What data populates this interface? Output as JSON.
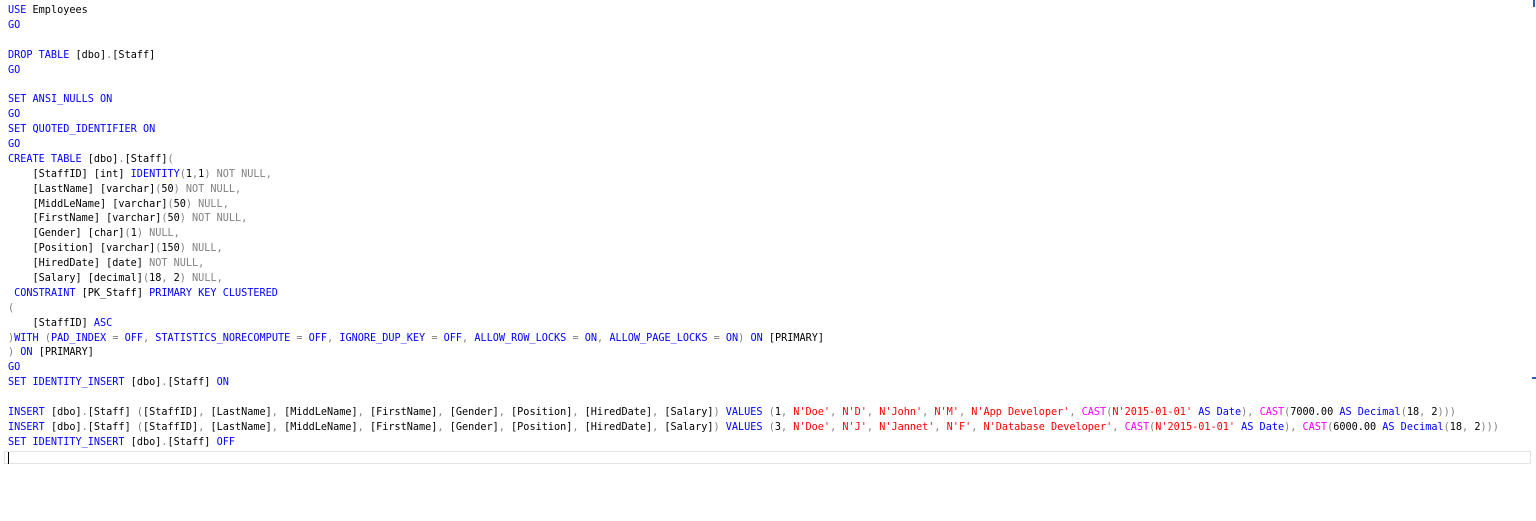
{
  "editor": {
    "colors": {
      "keyword": "#0000ff",
      "string": "#ff0000",
      "gray": "#808080",
      "function": "#ff00ff",
      "identifier": "#000000"
    },
    "lines": [
      [
        [
          "kw",
          "USE"
        ],
        [
          "id",
          " Employees"
        ]
      ],
      [
        [
          "kw",
          "GO"
        ]
      ],
      [],
      [
        [
          "kw",
          "DROP TABLE"
        ],
        [
          "id",
          " [dbo]"
        ],
        [
          "gr",
          "."
        ],
        [
          "id",
          "[Staff]"
        ]
      ],
      [
        [
          "kw",
          "GO"
        ]
      ],
      [],
      [
        [
          "kw",
          "SET"
        ],
        [
          "id",
          " "
        ],
        [
          "kw",
          "ANSI_NULLS ON"
        ]
      ],
      [
        [
          "kw",
          "GO"
        ]
      ],
      [
        [
          "kw",
          "SET"
        ],
        [
          "id",
          " "
        ],
        [
          "kw",
          "QUOTED_IDENTIFIER ON"
        ]
      ],
      [
        [
          "kw",
          "GO"
        ]
      ],
      [
        [
          "kw",
          "CREATE TABLE"
        ],
        [
          "id",
          " [dbo]"
        ],
        [
          "gr",
          "."
        ],
        [
          "id",
          "[Staff]"
        ],
        [
          "gr",
          "("
        ]
      ],
      [
        [
          "id",
          "    [StaffID] [int] "
        ],
        [
          "kw",
          "IDENTITY"
        ],
        [
          "gr",
          "("
        ],
        [
          "id",
          "1"
        ],
        [
          "gr",
          ","
        ],
        [
          "id",
          "1"
        ],
        [
          "gr",
          ") NOT NULL,"
        ]
      ],
      [
        [
          "id",
          "    [LastName] [varchar]"
        ],
        [
          "gr",
          "("
        ],
        [
          "id",
          "50"
        ],
        [
          "gr",
          ") NOT NULL,"
        ]
      ],
      [
        [
          "id",
          "    [MiddLeName] [varchar]"
        ],
        [
          "gr",
          "("
        ],
        [
          "id",
          "50"
        ],
        [
          "gr",
          ") NULL,"
        ]
      ],
      [
        [
          "id",
          "    [FirstName] [varchar]"
        ],
        [
          "gr",
          "("
        ],
        [
          "id",
          "50"
        ],
        [
          "gr",
          ") NOT NULL,"
        ]
      ],
      [
        [
          "id",
          "    [Gender] [char]"
        ],
        [
          "gr",
          "("
        ],
        [
          "id",
          "1"
        ],
        [
          "gr",
          ") NULL,"
        ]
      ],
      [
        [
          "id",
          "    [Position] [varchar]"
        ],
        [
          "gr",
          "("
        ],
        [
          "id",
          "150"
        ],
        [
          "gr",
          ") NULL,"
        ]
      ],
      [
        [
          "id",
          "    [HiredDate] [date] "
        ],
        [
          "gr",
          "NOT NULL,"
        ]
      ],
      [
        [
          "id",
          "    [Salary] [decimal]"
        ],
        [
          "gr",
          "("
        ],
        [
          "id",
          "18"
        ],
        [
          "gr",
          ","
        ],
        [
          "id",
          " 2"
        ],
        [
          "gr",
          ") NULL,"
        ]
      ],
      [
        [
          "id",
          " "
        ],
        [
          "kw",
          "CONSTRAINT"
        ],
        [
          "id",
          " [PK_Staff] "
        ],
        [
          "kw",
          "PRIMARY KEY CLUSTERED"
        ]
      ],
      [
        [
          "gr",
          "("
        ]
      ],
      [
        [
          "id",
          "    [StaffID] "
        ],
        [
          "kw",
          "ASC"
        ]
      ],
      [
        [
          "gr",
          ")"
        ],
        [
          "kw",
          "WITH"
        ],
        [
          "id",
          " "
        ],
        [
          "gr",
          "("
        ],
        [
          "kw",
          "PAD_INDEX"
        ],
        [
          "id",
          " "
        ],
        [
          "gr",
          "="
        ],
        [
          "id",
          " "
        ],
        [
          "kw",
          "OFF"
        ],
        [
          "gr",
          ","
        ],
        [
          "id",
          " "
        ],
        [
          "kw",
          "STATISTICS_NORECOMPUTE"
        ],
        [
          "id",
          " "
        ],
        [
          "gr",
          "="
        ],
        [
          "id",
          " "
        ],
        [
          "kw",
          "OFF"
        ],
        [
          "gr",
          ","
        ],
        [
          "id",
          " "
        ],
        [
          "kw",
          "IGNORE_DUP_KEY"
        ],
        [
          "id",
          " "
        ],
        [
          "gr",
          "="
        ],
        [
          "id",
          " "
        ],
        [
          "kw",
          "OFF"
        ],
        [
          "gr",
          ","
        ],
        [
          "id",
          " "
        ],
        [
          "kw",
          "ALLOW_ROW_LOCKS"
        ],
        [
          "id",
          " "
        ],
        [
          "gr",
          "="
        ],
        [
          "id",
          " "
        ],
        [
          "kw",
          "ON"
        ],
        [
          "gr",
          ","
        ],
        [
          "id",
          " "
        ],
        [
          "kw",
          "ALLOW_PAGE_LOCKS"
        ],
        [
          "id",
          " "
        ],
        [
          "gr",
          "="
        ],
        [
          "id",
          " "
        ],
        [
          "kw",
          "ON"
        ],
        [
          "gr",
          ")"
        ],
        [
          "id",
          " "
        ],
        [
          "kw",
          "ON"
        ],
        [
          "id",
          " [PRIMARY]"
        ]
      ],
      [
        [
          "gr",
          ")"
        ],
        [
          "id",
          " "
        ],
        [
          "kw",
          "ON"
        ],
        [
          "id",
          " [PRIMARY]"
        ]
      ],
      [
        [
          "kw",
          "GO"
        ]
      ],
      [
        [
          "kw",
          "SET IDENTITY_INSERT"
        ],
        [
          "id",
          " [dbo]"
        ],
        [
          "gr",
          "."
        ],
        [
          "id",
          "[Staff] "
        ],
        [
          "kw",
          "ON"
        ]
      ],
      [],
      [
        [
          "kw",
          "INSERT"
        ],
        [
          "id",
          " [dbo]"
        ],
        [
          "gr",
          "."
        ],
        [
          "id",
          "[Staff] "
        ],
        [
          "gr",
          "("
        ],
        [
          "id",
          "[StaffID]"
        ],
        [
          "gr",
          ","
        ],
        [
          "id",
          " [LastName]"
        ],
        [
          "gr",
          ","
        ],
        [
          "id",
          " [MiddLeName]"
        ],
        [
          "gr",
          ","
        ],
        [
          "id",
          " [FirstName]"
        ],
        [
          "gr",
          ","
        ],
        [
          "id",
          " [Gender]"
        ],
        [
          "gr",
          ","
        ],
        [
          "id",
          " [Position]"
        ],
        [
          "gr",
          ","
        ],
        [
          "id",
          " [HiredDate]"
        ],
        [
          "gr",
          ","
        ],
        [
          "id",
          " [Salary]"
        ],
        [
          "gr",
          ")"
        ],
        [
          "id",
          " "
        ],
        [
          "kw",
          "VALUES"
        ],
        [
          "id",
          " "
        ],
        [
          "gr",
          "("
        ],
        [
          "id",
          "1"
        ],
        [
          "gr",
          ","
        ],
        [
          "id",
          " "
        ],
        [
          "st",
          "N'Doe'"
        ],
        [
          "gr",
          ","
        ],
        [
          "id",
          " "
        ],
        [
          "st",
          "N'D'"
        ],
        [
          "gr",
          ","
        ],
        [
          "id",
          " "
        ],
        [
          "st",
          "N'John'"
        ],
        [
          "gr",
          ","
        ],
        [
          "id",
          " "
        ],
        [
          "st",
          "N'M'"
        ],
        [
          "gr",
          ","
        ],
        [
          "id",
          " "
        ],
        [
          "st",
          "N'App Developer'"
        ],
        [
          "gr",
          ","
        ],
        [
          "id",
          " "
        ],
        [
          "fn",
          "CAST"
        ],
        [
          "gr",
          "("
        ],
        [
          "st",
          "N'2015-01-01'"
        ],
        [
          "id",
          " "
        ],
        [
          "kw",
          "AS Date"
        ],
        [
          "gr",
          "),"
        ],
        [
          "id",
          " "
        ],
        [
          "fn",
          "CAST"
        ],
        [
          "gr",
          "("
        ],
        [
          "id",
          "7000.00 "
        ],
        [
          "kw",
          "AS Decimal"
        ],
        [
          "gr",
          "("
        ],
        [
          "id",
          "18"
        ],
        [
          "gr",
          ","
        ],
        [
          "id",
          " 2"
        ],
        [
          "gr",
          ")))"
        ]
      ],
      [
        [
          "kw",
          "INSERT"
        ],
        [
          "id",
          " [dbo]"
        ],
        [
          "gr",
          "."
        ],
        [
          "id",
          "[Staff] "
        ],
        [
          "gr",
          "("
        ],
        [
          "id",
          "[StaffID]"
        ],
        [
          "gr",
          ","
        ],
        [
          "id",
          " [LastName]"
        ],
        [
          "gr",
          ","
        ],
        [
          "id",
          " [MiddLeName]"
        ],
        [
          "gr",
          ","
        ],
        [
          "id",
          " [FirstName]"
        ],
        [
          "gr",
          ","
        ],
        [
          "id",
          " [Gender]"
        ],
        [
          "gr",
          ","
        ],
        [
          "id",
          " [Position]"
        ],
        [
          "gr",
          ","
        ],
        [
          "id",
          " [HiredDate]"
        ],
        [
          "gr",
          ","
        ],
        [
          "id",
          " [Salary]"
        ],
        [
          "gr",
          ")"
        ],
        [
          "id",
          " "
        ],
        [
          "kw",
          "VALUES"
        ],
        [
          "id",
          " "
        ],
        [
          "gr",
          "("
        ],
        [
          "id",
          "3"
        ],
        [
          "gr",
          ","
        ],
        [
          "id",
          " "
        ],
        [
          "st",
          "N'Doe'"
        ],
        [
          "gr",
          ","
        ],
        [
          "id",
          " "
        ],
        [
          "st",
          "N'J'"
        ],
        [
          "gr",
          ","
        ],
        [
          "id",
          " "
        ],
        [
          "st",
          "N'Jannet'"
        ],
        [
          "gr",
          ","
        ],
        [
          "id",
          " "
        ],
        [
          "st",
          "N'F'"
        ],
        [
          "gr",
          ","
        ],
        [
          "id",
          " "
        ],
        [
          "st",
          "N'Database Developer'"
        ],
        [
          "gr",
          ","
        ],
        [
          "id",
          " "
        ],
        [
          "fn",
          "CAST"
        ],
        [
          "gr",
          "("
        ],
        [
          "st",
          "N'2015-01-01'"
        ],
        [
          "id",
          " "
        ],
        [
          "kw",
          "AS Date"
        ],
        [
          "gr",
          "),"
        ],
        [
          "id",
          " "
        ],
        [
          "fn",
          "CAST"
        ],
        [
          "gr",
          "("
        ],
        [
          "id",
          "6000.00 "
        ],
        [
          "kw",
          "AS Decimal"
        ],
        [
          "gr",
          "("
        ],
        [
          "id",
          "18"
        ],
        [
          "gr",
          ","
        ],
        [
          "id",
          " 2"
        ],
        [
          "gr",
          ")))"
        ]
      ],
      [
        [
          "kw",
          "SET IDENTITY_INSERT"
        ],
        [
          "id",
          " [dbo]"
        ],
        [
          "gr",
          "."
        ],
        [
          "id",
          "[Staff] "
        ],
        [
          "kw",
          "OFF"
        ]
      ],
      []
    ]
  }
}
